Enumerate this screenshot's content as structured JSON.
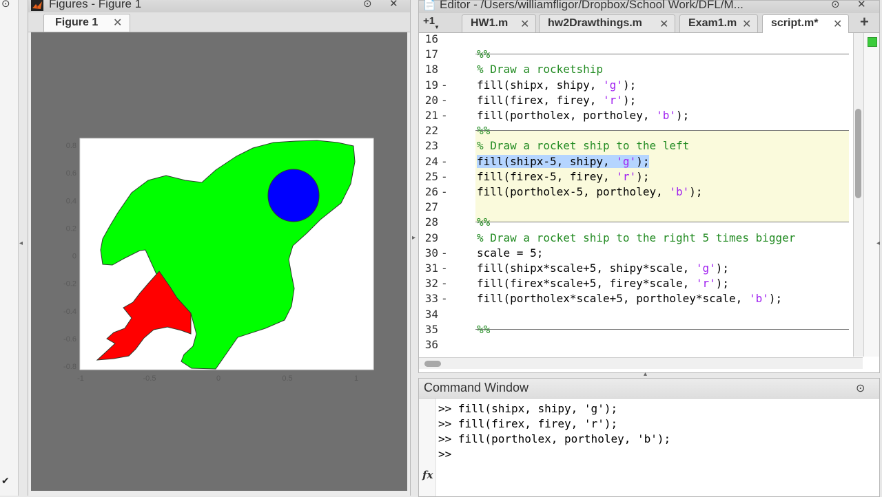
{
  "figures": {
    "window_title": "Figures - Figure 1",
    "tab_label": "Figure 1",
    "close_glyph": "✕",
    "menu_glyph": "⊙",
    "axes": {
      "x_ticks": [
        "-1",
        "-0.5",
        "0",
        "0.5",
        "1"
      ],
      "y_ticks": [
        "0.8",
        "0.6",
        "0.4",
        "0.2",
        "0",
        "-0.2",
        "-0.4",
        "-0.6",
        "-0.8"
      ]
    },
    "colors": {
      "ship": "#00ff00",
      "fire": "#ff0000",
      "porthole": "#0000ff",
      "canvas": "#707070"
    }
  },
  "editor": {
    "window_title": "Editor - /Users/williamfligor/Dropbox/School Work/DFL/M...",
    "menu_glyph": "⊙",
    "close_glyph": "✕",
    "overflow_label": "+1",
    "add_tab_label": "+",
    "tabs": [
      {
        "label": "HW1.m",
        "active": false
      },
      {
        "label": "hw2Drawthings.m",
        "active": false
      },
      {
        "label": "Exam1.m",
        "active": false
      },
      {
        "label": "script.m*",
        "active": true
      }
    ],
    "lines": [
      {
        "n": "16",
        "dash": "",
        "text": ""
      },
      {
        "n": "17",
        "dash": "",
        "text": "%%"
      },
      {
        "n": "18",
        "dash": "",
        "text": "% Draw a rocketship"
      },
      {
        "n": "19",
        "dash": "-",
        "text": "fill(shipx, shipy, 'g');"
      },
      {
        "n": "20",
        "dash": "-",
        "text": "fill(firex, firey, 'r');"
      },
      {
        "n": "21",
        "dash": "-",
        "text": "fill(portholex, portholey, 'b');"
      },
      {
        "n": "22",
        "dash": "",
        "text": "%%"
      },
      {
        "n": "23",
        "dash": "",
        "text": "% Draw a rocket ship to the left"
      },
      {
        "n": "24",
        "dash": "-",
        "text": "fill(shipx-5, shipy, 'g');"
      },
      {
        "n": "25",
        "dash": "-",
        "text": "fill(firex-5, firey, 'r');"
      },
      {
        "n": "26",
        "dash": "-",
        "text": "fill(portholex-5, portholey, 'b');"
      },
      {
        "n": "27",
        "dash": "",
        "text": ""
      },
      {
        "n": "28",
        "dash": "",
        "text": "%%"
      },
      {
        "n": "29",
        "dash": "",
        "text": "% Draw a rocket ship to the right 5 times bigger"
      },
      {
        "n": "30",
        "dash": "-",
        "text": "scale = 5;"
      },
      {
        "n": "31",
        "dash": "-",
        "text": "fill(shipx*scale+5, shipy*scale, 'g');"
      },
      {
        "n": "32",
        "dash": "-",
        "text": "fill(firex*scale+5, firey*scale, 'r');"
      },
      {
        "n": "33",
        "dash": "-",
        "text": "fill(portholex*scale+5, portholey*scale, 'b');"
      },
      {
        "n": "34",
        "dash": "",
        "text": ""
      },
      {
        "n": "35",
        "dash": "",
        "text": "%%"
      },
      {
        "n": "36",
        "dash": "",
        "text": ""
      }
    ],
    "selected_line": "24",
    "highlighted_cell_lines": [
      "22",
      "23",
      "24",
      "25",
      "26",
      "27"
    ],
    "cell_break_lines": [
      "17",
      "22",
      "28",
      "35"
    ],
    "colors": {
      "comment": "#228b22",
      "string": "#a020f0",
      "cell_highlight": "#fafadc",
      "selection": "#b5d5ff"
    }
  },
  "command_window": {
    "title": "Command Window",
    "menu_glyph": "⊙",
    "history": [
      ">> fill(shipx, shipy, 'g');",
      ">> fill(firex, firey, 'r');",
      ">> fill(portholex, portholey, 'b');"
    ],
    "prompt": ">>",
    "fx_label": "fx"
  }
}
